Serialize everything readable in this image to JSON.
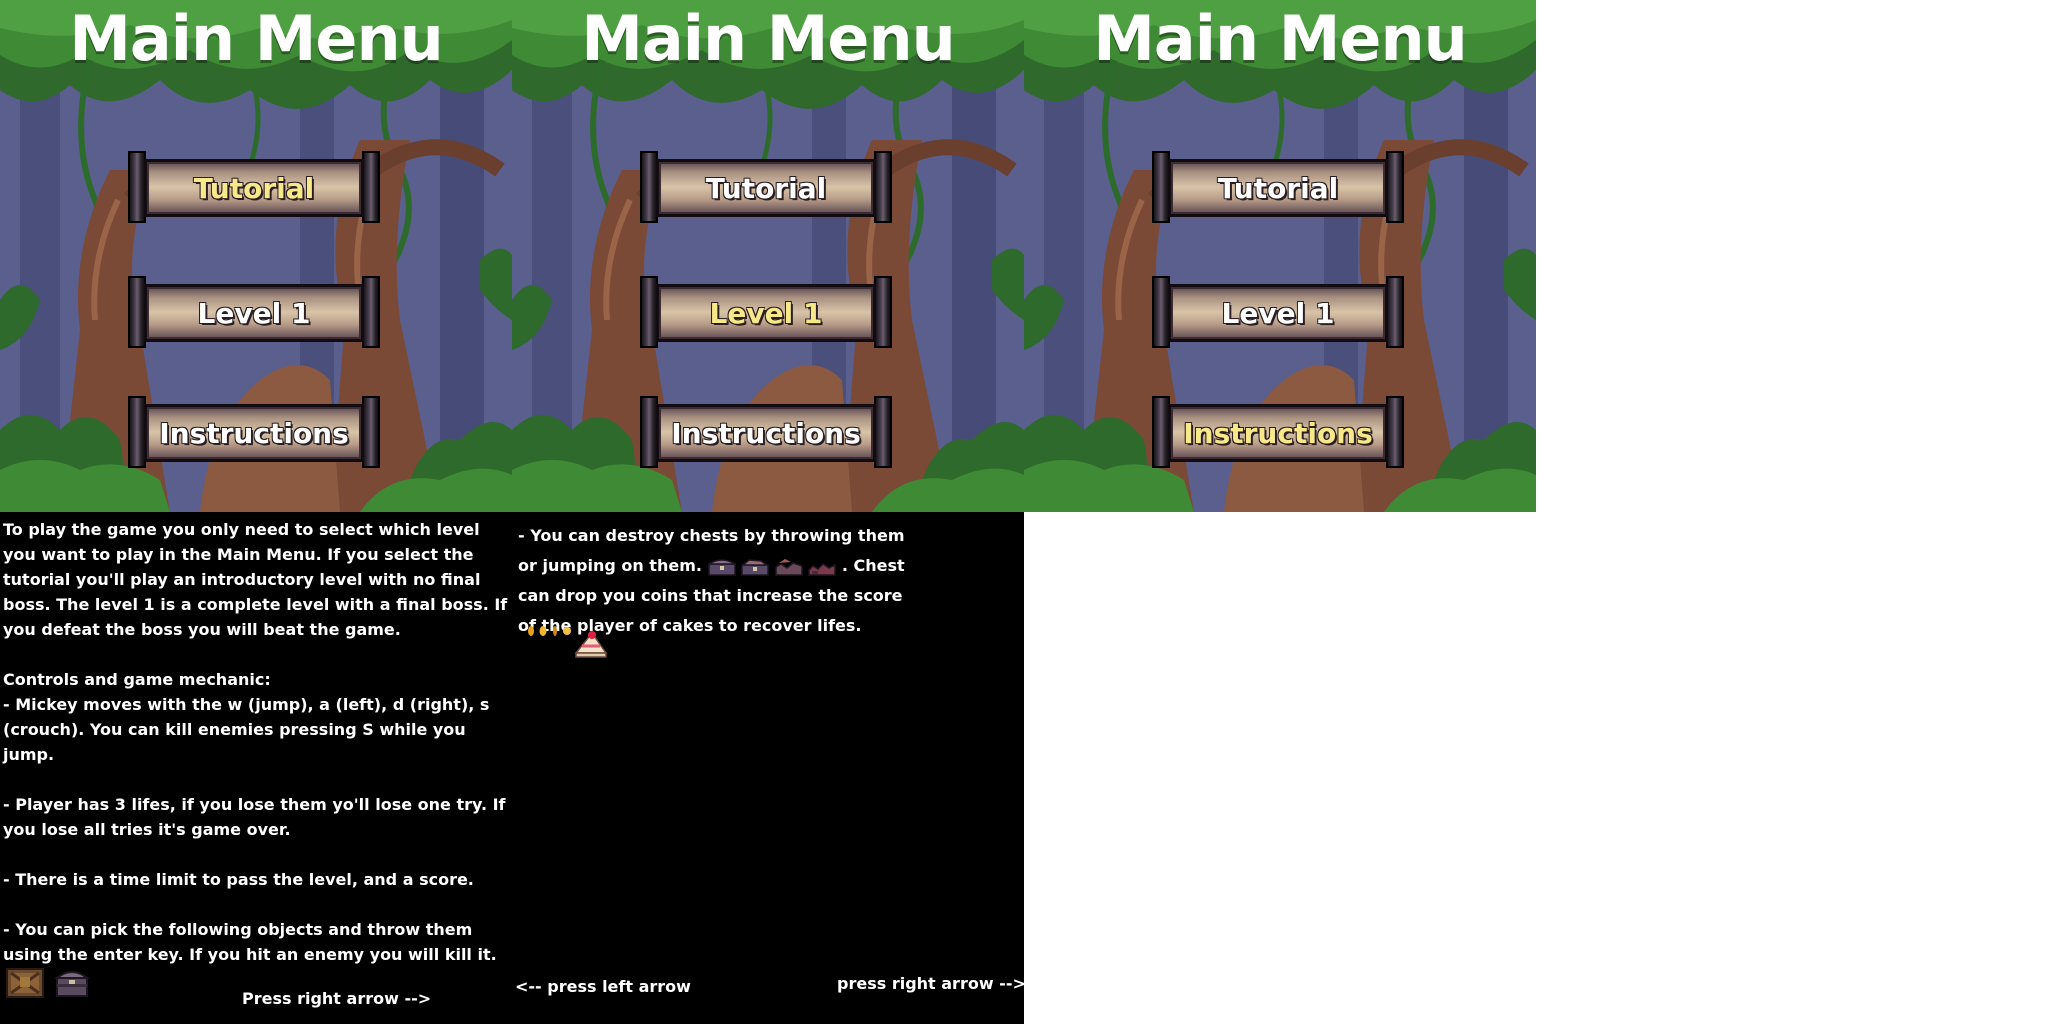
{
  "menu_screens": [
    {
      "title": "Main Menu",
      "buttons": [
        "Tutorial",
        "Level 1",
        "Instructions"
      ],
      "selected": "Tutorial"
    },
    {
      "title": "Main Menu",
      "buttons": [
        "Tutorial",
        "Level 1",
        "Instructions"
      ],
      "selected": "Level 1"
    },
    {
      "title": "Main Menu",
      "buttons": [
        "Tutorial",
        "Level 1",
        "Instructions"
      ],
      "selected": "Instructions"
    }
  ],
  "instructions_page_1": {
    "intro": "To play the game you only need to select which level you want to play in the Main Menu. If you select the tutorial you'll play an introductory level with no final boss. The level 1 is  a complete level with a final boss. If you defeat the boss you will beat the game.",
    "controls_heading": "Controls and game mechanic:",
    "controls_text": "- Mickey moves with the w (jump), a (left), d (right), s (crouch). You can kill enemies pressing S while you jump.",
    "lives_text": "- Player has 3 lifes, if you lose them yo'll lose one try. If you lose all tries it's game over.",
    "time_text": "- There is a time limit to pass the level, and a score.",
    "pickup_text": "- You can pick the following objects and throw them using the enter key. If you hit an enemy you will kill it.",
    "next_label": "Press right arrow -->",
    "pickup_icons": [
      "crate-icon",
      "chest-icon"
    ]
  },
  "instructions_page_2": {
    "chests_part1": "- You can destroy chests by throwing them or jumping on them.",
    "chests_part2": ". Chest can drop you coins that increase the score of the player of cakes to recover lifes.",
    "prev_label": "<-- press left arrow",
    "next_label": "press right arrow -->",
    "chest_icons": [
      "chest-frame-1-icon",
      "chest-frame-2-icon",
      "chest-frame-3-icon",
      "chest-frame-4-icon"
    ],
    "drop_icons": [
      "coin-icon",
      "cake-icon"
    ]
  },
  "colors": {
    "selected_label": "#f7e98a",
    "normal_label": "#ffffff",
    "text_panel_bg": "#000000"
  }
}
